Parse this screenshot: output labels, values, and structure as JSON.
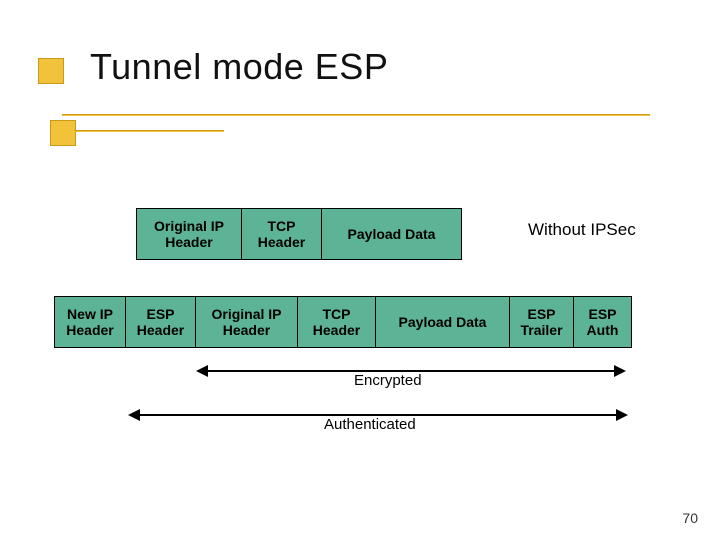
{
  "title": "Tunnel mode ESP",
  "without_label": "Without IPSec",
  "row1": {
    "original_ip_header": "Original IP\nHeader",
    "tcp_header": "TCP\nHeader",
    "payload_data": "Payload Data"
  },
  "row2": {
    "new_ip_header": "New IP\nHeader",
    "esp_header": "ESP\nHeader",
    "original_ip_header": "Original IP\nHeader",
    "tcp_header": "TCP\nHeader",
    "payload_data": "Payload Data",
    "esp_trailer": "ESP\nTrailer",
    "esp_auth": "ESP\nAuth"
  },
  "encrypted_label": "Encrypted",
  "authenticated_label": "Authenticated",
  "page_number": "70"
}
